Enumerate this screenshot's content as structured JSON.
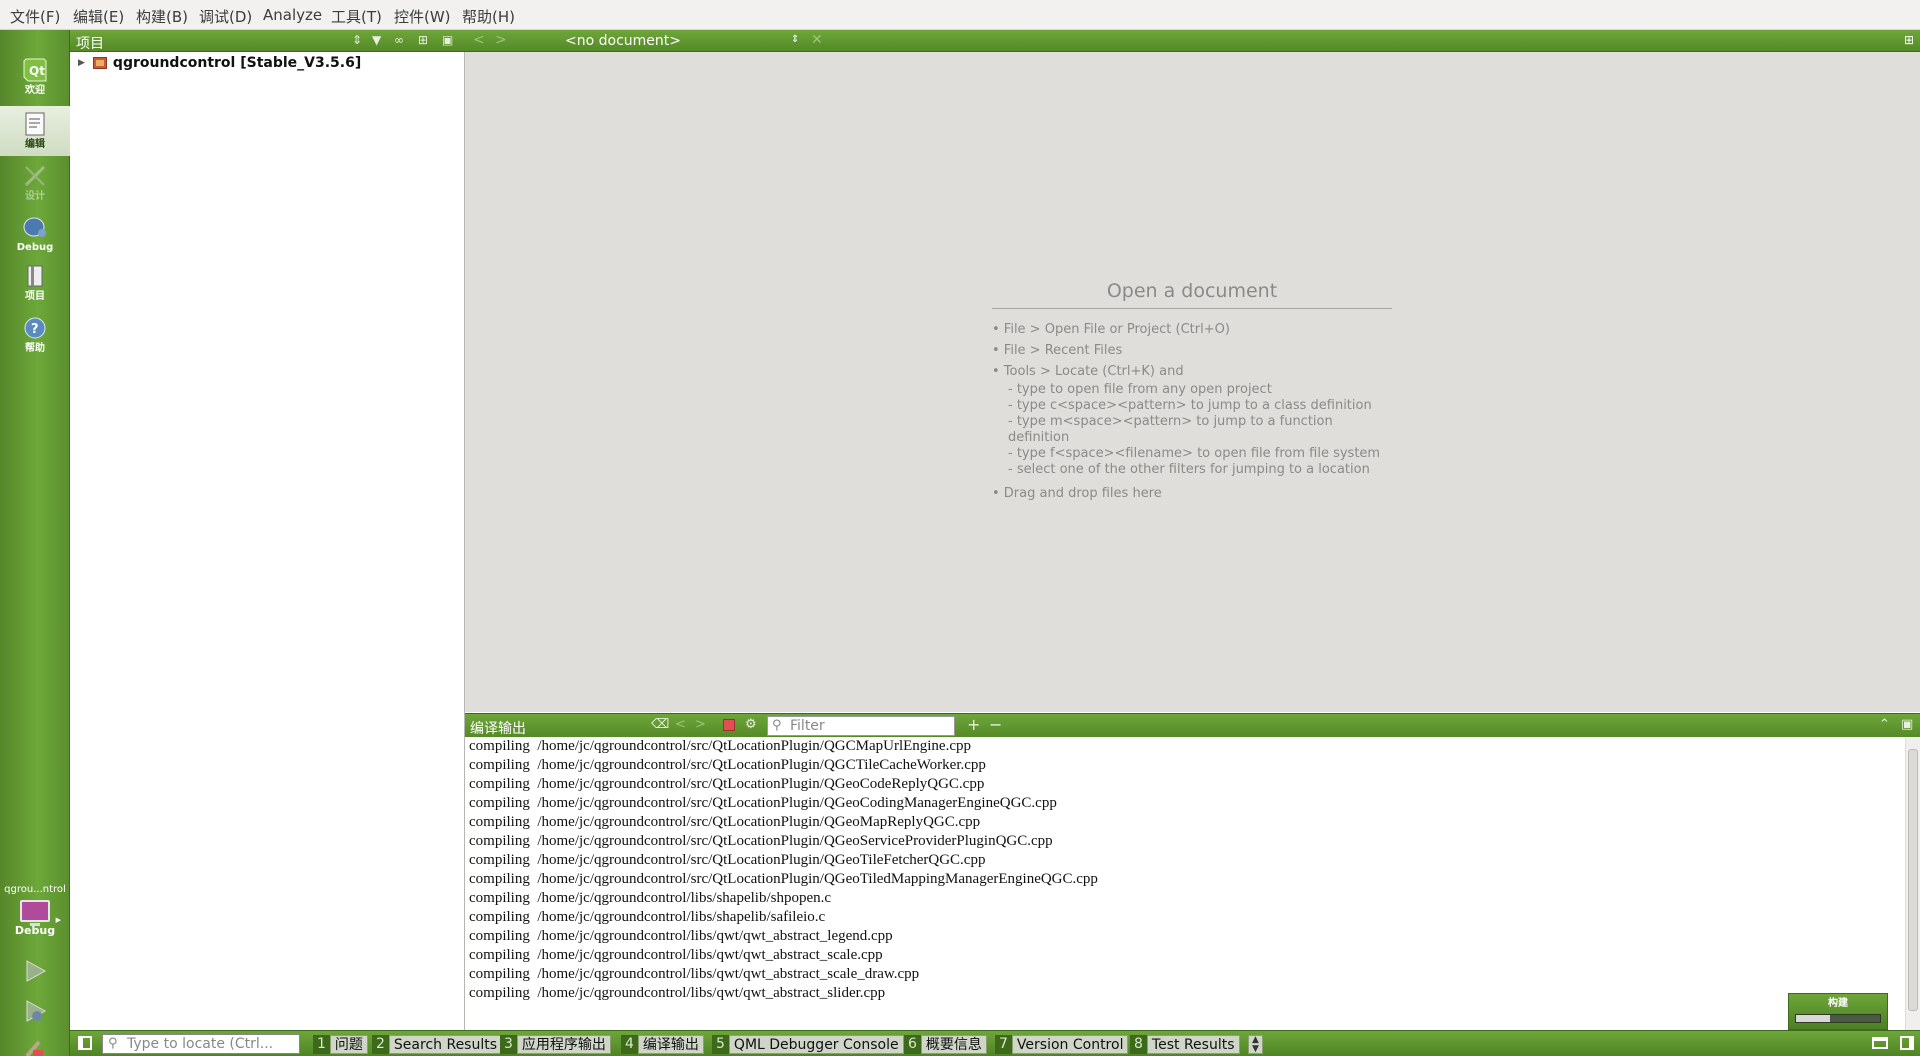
{
  "menu": [
    "文件(F)",
    "编辑(E)",
    "构建(B)",
    "调试(D)",
    "Analyze",
    "工具(T)",
    "控件(W)",
    "帮助(H)"
  ],
  "modes": [
    {
      "label": "欢迎",
      "icon": "qt-logo-icon"
    },
    {
      "label": "编辑",
      "icon": "edit-document-icon"
    },
    {
      "label": "设计",
      "icon": "design-pen-icon"
    },
    {
      "label": "Debug",
      "icon": "debug-bug-icon"
    },
    {
      "label": "项目",
      "icon": "projects-icon"
    },
    {
      "label": "帮助",
      "icon": "help-icon"
    }
  ],
  "kit": {
    "name": "qgrou...ntrol",
    "label": "Debug"
  },
  "project_panel": {
    "title": "项目",
    "tree": [
      {
        "label": "qgroundcontrol [Stable_V3.5.6]"
      }
    ]
  },
  "editor": {
    "document": "<no document>",
    "welcome_title": "Open a document",
    "items": [
      "• File > Open File or Project (Ctrl+O)",
      "• File > Recent Files",
      "• Tools > Locate (Ctrl+K) and"
    ],
    "sub_items": [
      "- type to open file from any open project",
      "- type c<space><pattern> to jump to a class definition",
      "- type m<space><pattern> to jump to a function definition",
      "- type f<space><filename> to open file from file system",
      "- select one of the other filters for jumping to a location"
    ],
    "last_item": "• Drag and drop files here"
  },
  "output": {
    "title": "编译输出",
    "filter_placeholder": "Filter",
    "lines": [
      "compiling  /home/jc/qgroundcontrol/src/QtLocationPlugin/QGCMapUrlEngine.cpp",
      "compiling  /home/jc/qgroundcontrol/src/QtLocationPlugin/QGCTileCacheWorker.cpp",
      "compiling  /home/jc/qgroundcontrol/src/QtLocationPlugin/QGeoCodeReplyQGC.cpp",
      "compiling  /home/jc/qgroundcontrol/src/QtLocationPlugin/QGeoCodingManagerEngineQGC.cpp",
      "compiling  /home/jc/qgroundcontrol/src/QtLocationPlugin/QGeoMapReplyQGC.cpp",
      "compiling  /home/jc/qgroundcontrol/src/QtLocationPlugin/QGeoServiceProviderPluginQGC.cpp",
      "compiling  /home/jc/qgroundcontrol/src/QtLocationPlugin/QGeoTileFetcherQGC.cpp",
      "compiling  /home/jc/qgroundcontrol/src/QtLocationPlugin/QGeoTiledMappingManagerEngineQGC.cpp",
      "compiling  /home/jc/qgroundcontrol/libs/shapelib/shpopen.c",
      "compiling  /home/jc/qgroundcontrol/libs/shapelib/safileio.c",
      "compiling  /home/jc/qgroundcontrol/libs/qwt/qwt_abstract_legend.cpp",
      "compiling  /home/jc/qgroundcontrol/libs/qwt/qwt_abstract_scale.cpp",
      "compiling  /home/jc/qgroundcontrol/libs/qwt/qwt_abstract_scale_draw.cpp",
      "compiling  /home/jc/qgroundcontrol/libs/qwt/qwt_abstract_slider.cpp"
    ]
  },
  "build_progress": {
    "label": "构建",
    "fraction": 0.4
  },
  "statusbar": {
    "locate_placeholder": "Type to locate (Ctrl...",
    "panes": [
      {
        "num": "1",
        "label": "问题"
      },
      {
        "num": "2",
        "label": "Search Results"
      },
      {
        "num": "3",
        "label": "应用程序输出"
      },
      {
        "num": "4",
        "label": "编译输出"
      },
      {
        "num": "5",
        "label": "QML Debugger Console"
      },
      {
        "num": "6",
        "label": "概要信息"
      },
      {
        "num": "7",
        "label": "Version Control"
      },
      {
        "num": "8",
        "label": "Test Results"
      }
    ]
  },
  "colors": {
    "accent_green": "#6ea63a",
    "dark_green": "#3d6a1c",
    "stop_red": "#e05050"
  }
}
